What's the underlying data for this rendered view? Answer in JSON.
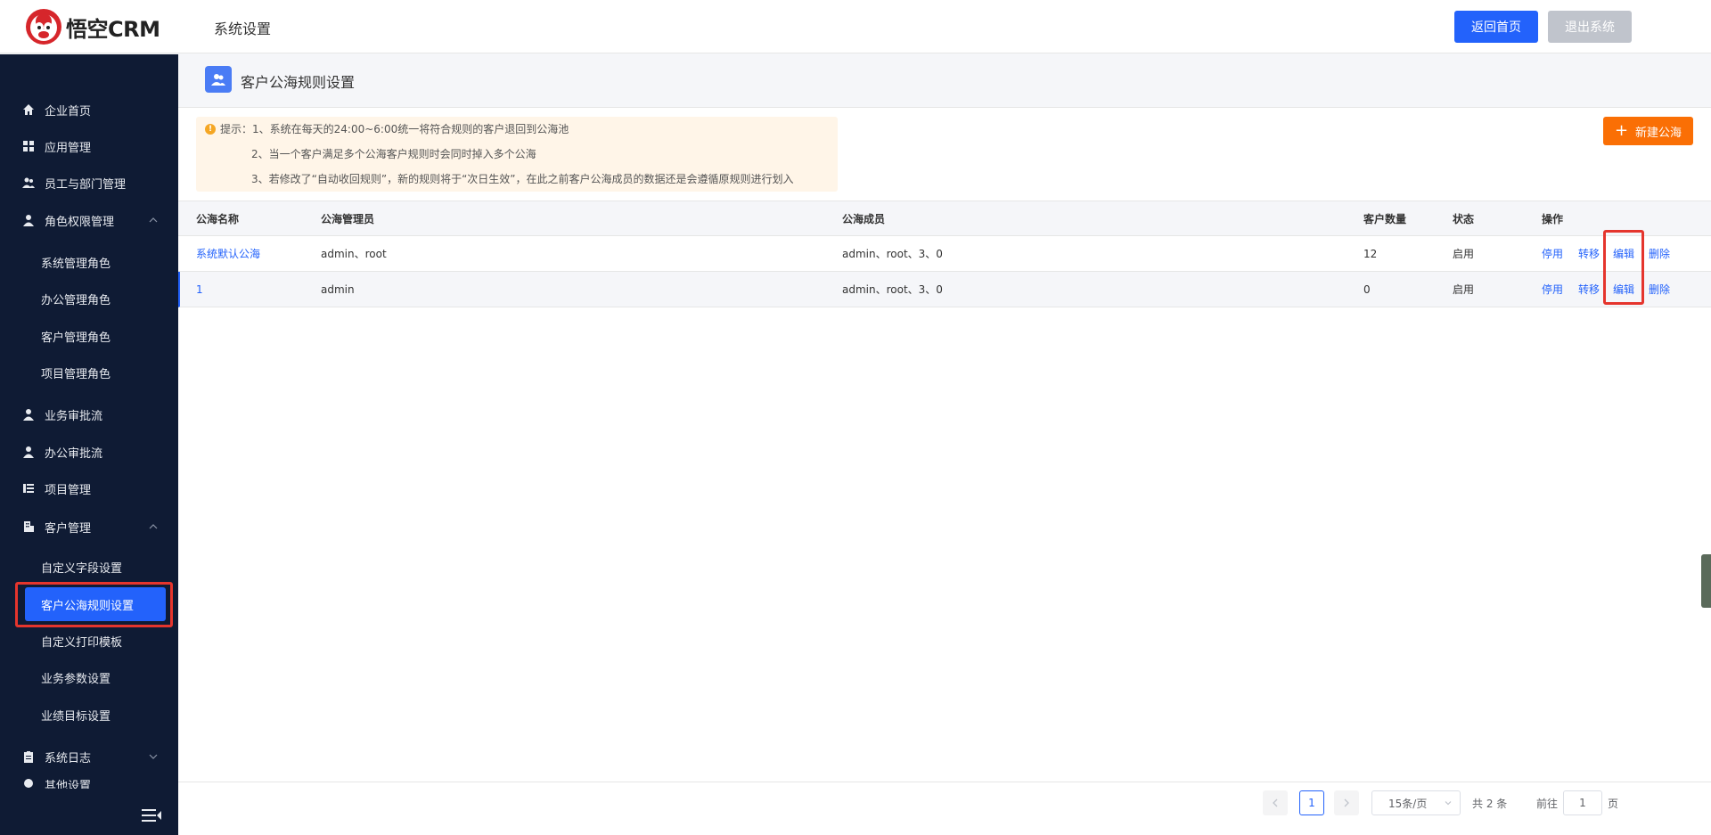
{
  "app": {
    "logo_text": "悟空CRM",
    "header_title": "系统设置",
    "home_button": "返回首页",
    "logout_button": "退出系统"
  },
  "sidebar": {
    "items": [
      {
        "label": "企业首页",
        "icon": "home-icon"
      },
      {
        "label": "应用管理",
        "icon": "grid-icon"
      },
      {
        "label": "员工与部门管理",
        "icon": "users-icon"
      },
      {
        "label": "角色权限管理",
        "icon": "user-icon"
      },
      {
        "label": "业务审批流",
        "icon": "user-icon"
      },
      {
        "label": "办公审批流",
        "icon": "user-icon"
      },
      {
        "label": "项目管理",
        "icon": "list-icon"
      },
      {
        "label": "客户管理",
        "icon": "building-icon"
      },
      {
        "label": "系统日志",
        "icon": "clipboard-icon"
      },
      {
        "label": "其他设置",
        "icon": "settings-icon"
      }
    ],
    "role_sub": [
      "系统管理角色",
      "办公管理角色",
      "客户管理角色",
      "项目管理角色"
    ],
    "customer_sub": [
      "自定义字段设置",
      "客户公海规则设置",
      "自定义打印模板",
      "业务参数设置",
      "业绩目标设置"
    ]
  },
  "page": {
    "title": "客户公海规则设置",
    "new_button": "新建公海",
    "tips": [
      "提示：1、系统在每天的24:00~6:00统一将符合规则的客户退回到公海池",
      "2、当一个客户满足多个公海客户规则时会同时掉入多个公海",
      "3、若修改了“自动收回规则”，新的规则将于“次日生效”，在此之前客户公海成员的数据还是会遵循原规则进行划入"
    ]
  },
  "table": {
    "headers": [
      "公海名称",
      "公海管理员",
      "公海成员",
      "客户数量",
      "状态",
      "操作"
    ],
    "rows": [
      {
        "name": "系统默认公海",
        "admins": "admin、root",
        "members": "admin、root、3、0",
        "count": "12",
        "status": "启用"
      },
      {
        "name": "1",
        "admins": "admin",
        "members": "admin、root、3、0",
        "count": "0",
        "status": "启用"
      }
    ],
    "actions": [
      "停用",
      "转移",
      "编辑",
      "删除"
    ]
  },
  "pagination": {
    "current_page": "1",
    "page_size": "15条/页",
    "total": "共 2 条",
    "goto_label": "前往",
    "goto_value": "1",
    "page_unit": "页"
  },
  "colors": {
    "primary": "#2362fb",
    "accent": "#fa6f05",
    "sidebar_bg": "#0f1b34",
    "highlight": "#e5352d"
  }
}
